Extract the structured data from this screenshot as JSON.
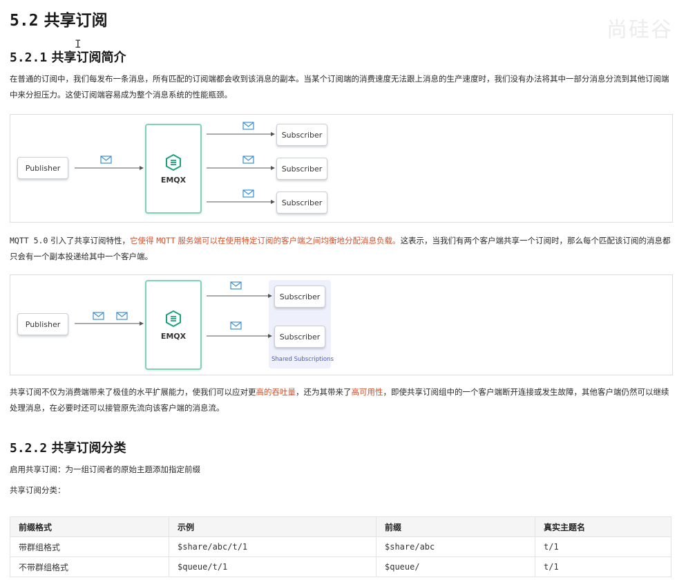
{
  "section": {
    "number": "5.2",
    "title": "共享订阅"
  },
  "intro": {
    "number": "5.2.1",
    "title": "共享订阅简介",
    "para1": "在普通的订阅中，我们每发布一条消息，所有匹配的订阅端都会收到该消息的副本。当某个订阅端的消费速度无法跟上消息的生产速度时，我们没有办法将其中一部分消息分流到其他订阅端中来分担压力。这使订阅端容易成为整个消息系统的性能瓶颈。",
    "para2_prefix": "MQTT 5.0",
    "para2_a": " 引入了共享订阅特性，",
    "para2_hl1": "它使得 ",
    "para2_hl_mono": "MQTT",
    "para2_hl2": " 服务端可以在使用特定订阅的客户端之间均衡地分配消息负载。",
    "para2_b": "这表示，当我们有两个客户端共享一个订阅时，那么每个匹配该订阅的消息都只会有一个副本投递给其中一个客户端。",
    "para3_a": "共享订阅不仅为消费端带来了极佳的水平扩展能力，使我们可以应对更",
    "para3_hl1": "高的吞吐量",
    "para3_b": "，还为其带来了",
    "para3_hl2": "高可用性",
    "para3_c": "，即使共享订阅组中的一个客户端断开连接或发生故障，其他客户端仍然可以继续处理消息，在必要时还可以接管原先流向该客户端的消息流。"
  },
  "diagram1": {
    "publisher": "Publisher",
    "broker": "EMQX",
    "subscribers": [
      "Subscriber",
      "Subscriber",
      "Subscriber"
    ]
  },
  "diagram2": {
    "publisher": "Publisher",
    "broker": "EMQX",
    "subscribers": [
      "Subscriber",
      "Subscriber"
    ],
    "group_caption": "Shared Subscriptions"
  },
  "classification": {
    "number": "5.2.2",
    "title": "共享订阅分类",
    "line1": "启用共享订阅：为一组订阅者的原始主题添加指定前缀",
    "line2": "共享订阅分类："
  },
  "table": {
    "headers": [
      "前缀格式",
      "示例",
      "前缀",
      "真实主题名"
    ],
    "rows": [
      [
        "带群组格式",
        "$share/abc/t/1",
        "$share/abc",
        "t/1"
      ],
      [
        "不带群组格式",
        "$queue/t/1",
        "$queue/",
        "t/1"
      ]
    ]
  },
  "watermark": "尚硅谷",
  "colors": {
    "accent_text": "#d4502a",
    "broker_border": "#7fd2b7",
    "broker_icon": "#1aa37a",
    "envelope": "#3a8fd6"
  },
  "icons": [
    "text-cursor-icon",
    "emqx-logo-icon",
    "envelope-icon",
    "arrow-icon"
  ]
}
